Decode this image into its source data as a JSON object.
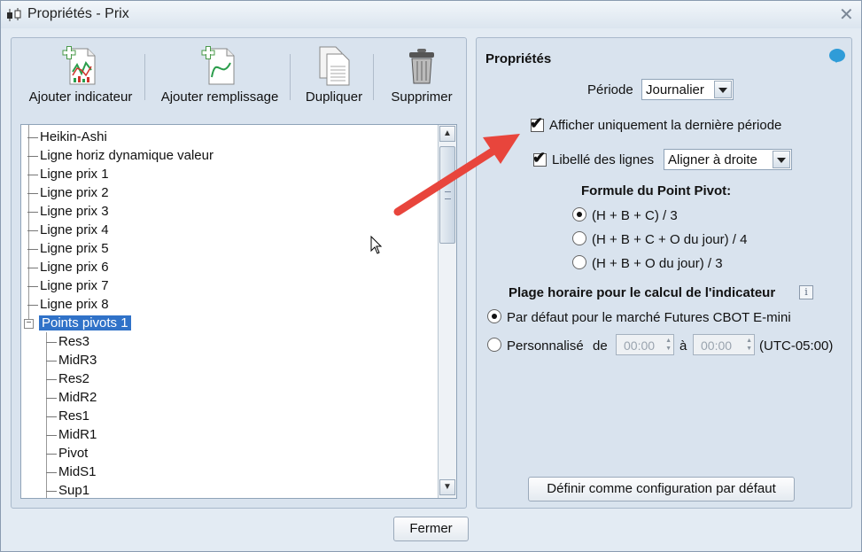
{
  "window": {
    "title": "Propriétés - Prix",
    "close_glyph": "✕"
  },
  "toolbar": {
    "add_indicator": "Ajouter indicateur",
    "add_fill": "Ajouter remplissage",
    "duplicate": "Dupliquer",
    "delete": "Supprimer"
  },
  "tree": {
    "items": [
      "Heikin-Ashi",
      "Ligne horiz dynamique valeur",
      "Ligne prix 1",
      "Ligne prix 2",
      "Ligne prix 3",
      "Ligne prix 4",
      "Ligne prix 5",
      "Ligne prix 6",
      "Ligne prix 7",
      "Ligne prix 8"
    ],
    "selected": "Points pivots 1",
    "children": [
      "Res3",
      "MidR3",
      "Res2",
      "MidR2",
      "Res1",
      "MidR1",
      "Pivot",
      "MidS1",
      "Sup1"
    ]
  },
  "properties": {
    "title": "Propriétés",
    "period_label": "Période",
    "period_value": "Journalier",
    "show_last_period": "Afficher uniquement la dernière période",
    "show_last_period_checked": true,
    "line_labels": "Libellé des lignes",
    "line_labels_checked": true,
    "line_labels_value": "Aligner à droite",
    "formula_title": "Formule du Point Pivot:",
    "formula_options": [
      "(H + B + C) / 3",
      "(H + B + C + O du jour) / 4",
      "(H + B + O du jour) / 3"
    ],
    "formula_selected": 0,
    "time_range_title": "Plage horaire pour le calcul de l'indicateur",
    "default_option": "Par défaut pour le marché Futures CBOT E-mini",
    "custom_option": "Personnalisé",
    "from_label": "de",
    "from_value": "00:00",
    "to_label": "à",
    "to_value": "00:00",
    "timezone": "(UTC-05:00)",
    "set_default_button": "Définir comme configuration par défaut"
  },
  "footer": {
    "close_button": "Fermer"
  },
  "colors": {
    "selection": "#3072c8",
    "annotation_arrow": "#e8453c",
    "help": "#2f9cd8"
  }
}
